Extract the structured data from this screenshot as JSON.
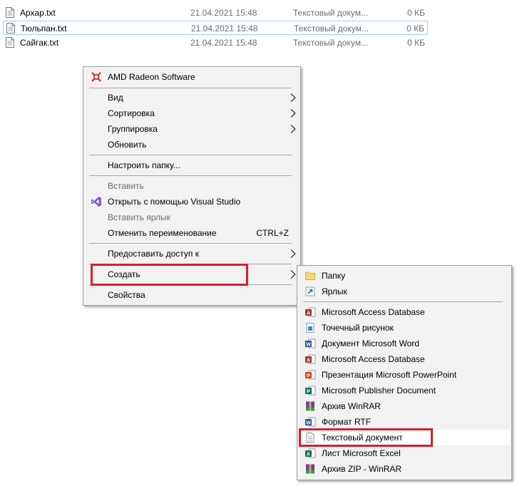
{
  "files": [
    {
      "name": "Архар.txt",
      "date": "21.04.2021 15:48",
      "type": "Текстовый докум...",
      "size": "0 КБ",
      "icon": "text-file-icon"
    },
    {
      "name": "Тюльпан.txt",
      "date": "21.04.2021 15:48",
      "type": "Текстовый докум...",
      "size": "0 КБ",
      "icon": "text-file-icon"
    },
    {
      "name": "Сайгак.txt",
      "date": "21.04.2021 15:48",
      "type": "Текстовый докум...",
      "size": "0 КБ",
      "icon": "text-file-icon"
    }
  ],
  "context_menu": {
    "amd": "AMD Radeon Software",
    "view": "Вид",
    "sort": "Сортировка",
    "group": "Группировка",
    "refresh": "Обновить",
    "customize": "Настроить папку...",
    "paste": "Вставить",
    "open_vs": "Открыть с помощью Visual Studio",
    "paste_shortcut": "Вставить ярлык",
    "undo_rename": "Отменить переименование",
    "undo_shortcut": "CTRL+Z",
    "share": "Предоставить доступ к",
    "create": "Создать",
    "properties": "Свойства"
  },
  "submenu": {
    "folder": "Папку",
    "shortcut": "Ярлык",
    "access1": "Microsoft Access Database",
    "bitmap": "Точечный рисунок",
    "word": "Документ Microsoft Word",
    "access2": "Microsoft Access Database",
    "powerpoint": "Презентация Microsoft PowerPoint",
    "publisher": "Microsoft Publisher Document",
    "winrar": "Архив WinRAR",
    "rtf": "Формат RTF",
    "text": "Текстовый документ",
    "excel": "Лист Microsoft Excel",
    "zip": "Архив ZIP - WinRAR"
  },
  "colors": {
    "highlight_border": "#d71f2b",
    "menu_bg": "#f2f2f2",
    "selection_border": "#99d1ff"
  }
}
